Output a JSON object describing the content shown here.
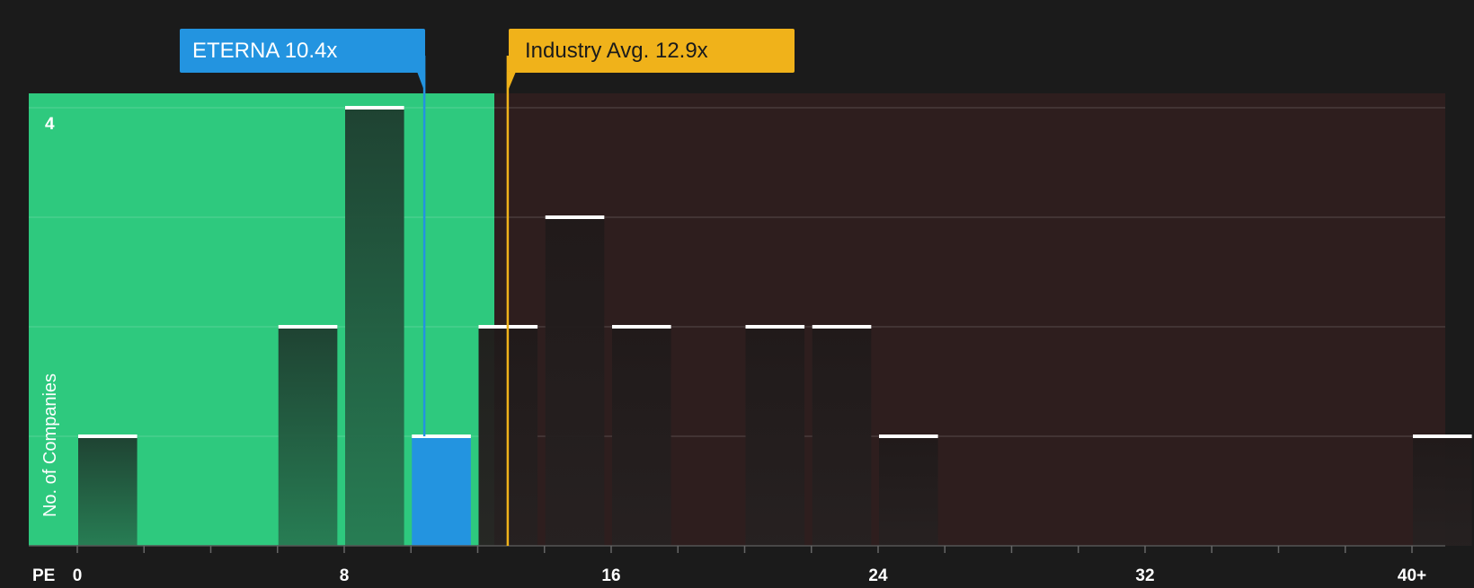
{
  "chart_data": {
    "type": "bar",
    "title": "",
    "xlabel": "PE",
    "ylabel": "No. of Companies",
    "xlim": [
      0,
      41
    ],
    "ylim": [
      0,
      4
    ],
    "bin_width": 1.9,
    "x_ticks": [
      {
        "value": 0,
        "label": "0"
      },
      {
        "value": 8,
        "label": "8"
      },
      {
        "value": 16,
        "label": "16"
      },
      {
        "value": 24,
        "label": "24"
      },
      {
        "value": 32,
        "label": "32"
      },
      {
        "value": 40,
        "label": "40+"
      }
    ],
    "y_ticks": [
      {
        "value": 4,
        "label": "4"
      }
    ],
    "bars": [
      {
        "x": 0,
        "value": 1
      },
      {
        "x": 6,
        "value": 2
      },
      {
        "x": 8,
        "value": 4
      },
      {
        "x": 10,
        "value": 1,
        "highlight": true
      },
      {
        "x": 12,
        "value": 2
      },
      {
        "x": 14,
        "value": 3
      },
      {
        "x": 16,
        "value": 2
      },
      {
        "x": 20,
        "value": 2
      },
      {
        "x": 22,
        "value": 2
      },
      {
        "x": 24,
        "value": 1
      },
      {
        "x": 40,
        "value": 1
      }
    ],
    "company": {
      "label": "ETERNA 10.4x",
      "value": 10.4,
      "color": "#2394e0"
    },
    "industry": {
      "label": "Industry Avg. 12.9x",
      "value": 12.9,
      "color": "#f0b21a"
    },
    "colors": {
      "background": "#1b1b1b",
      "undervalued_zone": "#2ec97e",
      "overvalued_zone": "#2e1e1e",
      "bar_in_green": "#1f4a35",
      "bar_in_red": "#262020",
      "bar_cap": "#ffffff",
      "grid": "#ffffff",
      "axis_text": "#ffffff"
    }
  }
}
